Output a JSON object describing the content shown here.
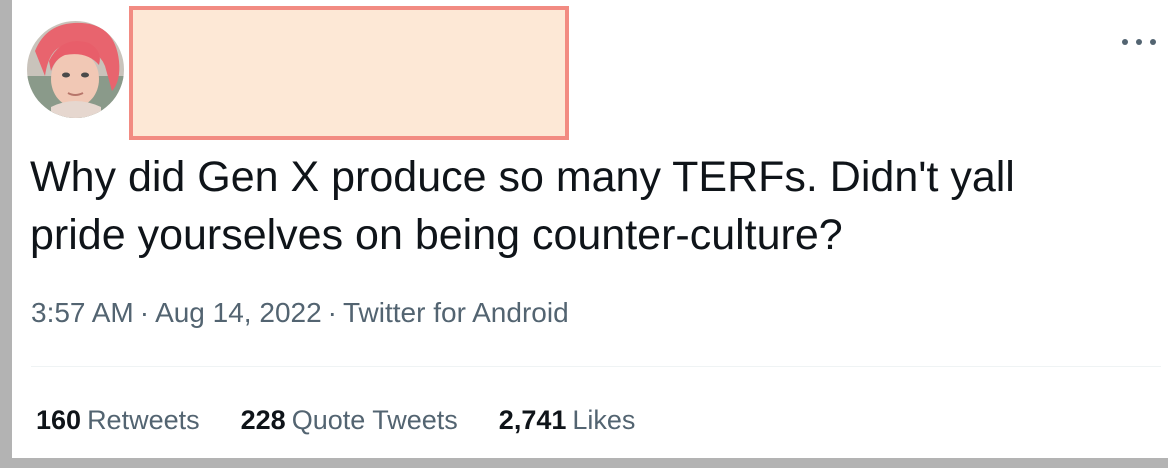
{
  "tweet": {
    "more_icon": "more-horizontal-icon",
    "text": "Why did Gen X produce so many TERFs. Didn't yall\npride yourselves on being counter-culture?",
    "time": "3:57 AM",
    "separator": "·",
    "date": "Aug 14, 2022",
    "source": "Twitter for Android"
  },
  "stats": {
    "retweets": {
      "count": "160",
      "label": "Retweets"
    },
    "quotes": {
      "count": "228",
      "label": "Quote Tweets"
    },
    "likes": {
      "count": "2,741",
      "label": "Likes"
    }
  },
  "colors": {
    "text": "#0f1419",
    "secondary": "#536471",
    "redaction_fill": "#fde8d6",
    "redaction_border": "#f28b82"
  }
}
